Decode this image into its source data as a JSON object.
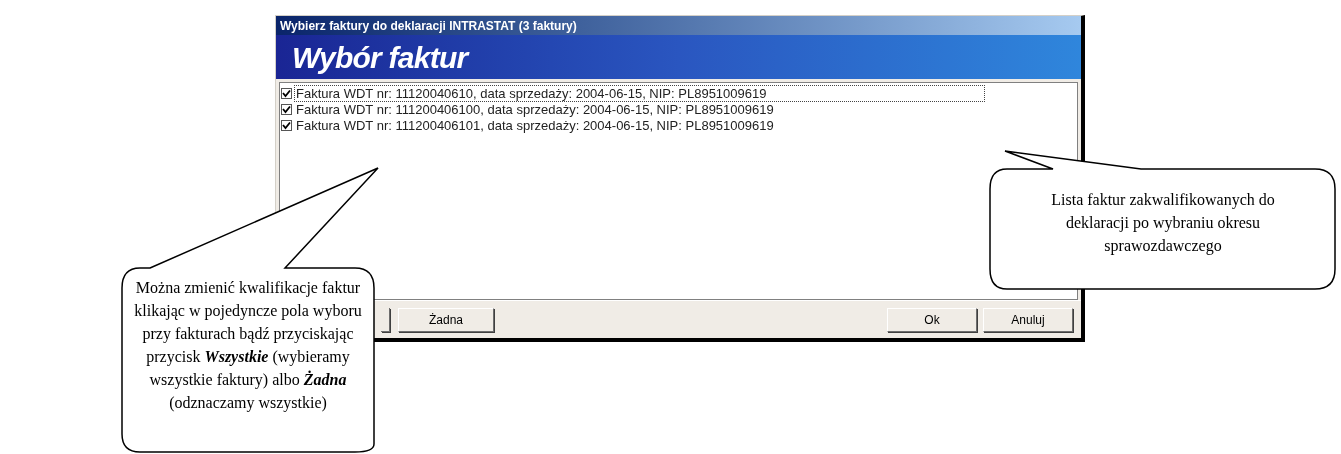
{
  "window": {
    "title": "Wybierz faktury do deklaracji INTRASTAT (3 faktury)"
  },
  "banner": {
    "title": "Wybór faktur"
  },
  "invoices": [
    {
      "label": "Faktura WDT nr: 11120040610, data sprzedaży: 2004-06-15, NIP: PL8951009619",
      "checked": true,
      "focused": true
    },
    {
      "label": "Faktura WDT nr: 111200406100, data sprzedaży: 2004-06-15, NIP: PL8951009619",
      "checked": true,
      "focused": false
    },
    {
      "label": "Faktura WDT nr: 111200406101, data sprzedaży: 2004-06-15, NIP: PL8951009619",
      "checked": true,
      "focused": false
    }
  ],
  "buttons_left": [
    {
      "label": "Żadna"
    }
  ],
  "buttons_right": [
    {
      "label": "Ok"
    },
    {
      "label": "Anuluj"
    }
  ],
  "callouts": [
    {
      "kind": "left",
      "text": "Można zmienić kwalifikacje faktur klikając w pojedyncze pola wyboru przy fakturach bądź przyciskając przycisk **Wszystkie** (wybieramy wszystkie faktury) albo **Żadna** (odznaczamy wszystkie)"
    },
    {
      "kind": "right",
      "text": "Lista faktur zakwalifikowanych do deklaracji po wybraniu okresu sprawozdawczego"
    }
  ]
}
